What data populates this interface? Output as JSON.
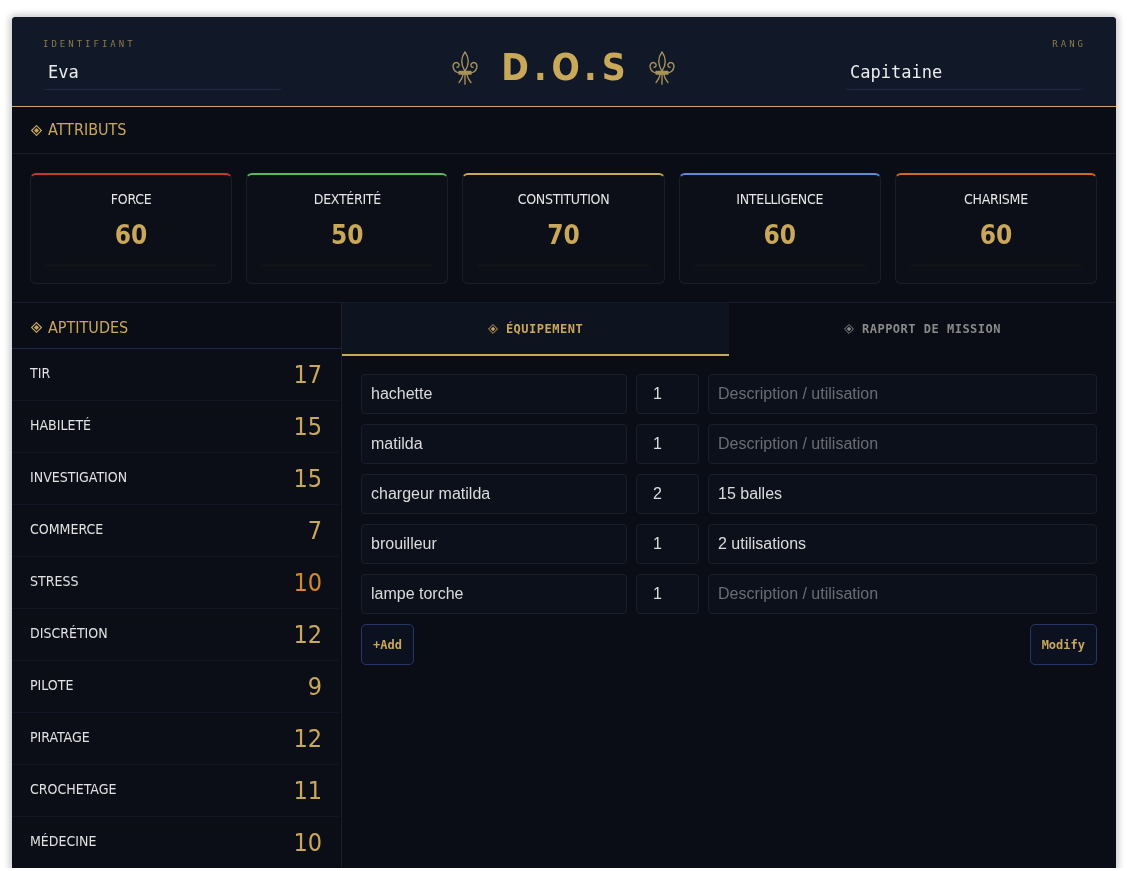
{
  "header": {
    "title": "D.O.S",
    "identity": {
      "label": "IDENTIFIANT",
      "value": "Eva"
    },
    "rank": {
      "label": "RANG",
      "value": "Capitaine"
    }
  },
  "attributes": {
    "title": "ATTRIBUTS",
    "items": [
      {
        "name": "FORCE",
        "value": "60",
        "color": "#c0392b"
      },
      {
        "name": "DEXTÉRITÉ",
        "value": "50",
        "color": "#5cb85c"
      },
      {
        "name": "CONSTITUTION",
        "value": "70",
        "color": "#c9a85a"
      },
      {
        "name": "INTELLIGENCE",
        "value": "60",
        "color": "#5b8ad6"
      },
      {
        "name": "CHARISME",
        "value": "60",
        "color": "#d2691e"
      }
    ]
  },
  "skills": {
    "title": "APTITUDES",
    "items": [
      {
        "name": "TIR",
        "value": "17",
        "alert": false
      },
      {
        "name": "HABILETÉ",
        "value": "15",
        "alert": false
      },
      {
        "name": "INVESTIGATION",
        "value": "15",
        "alert": false
      },
      {
        "name": "COMMERCE",
        "value": "7",
        "alert": false
      },
      {
        "name": "STRESS",
        "value": "10",
        "alert": true
      },
      {
        "name": "DISCRÉTION",
        "value": "12",
        "alert": false
      },
      {
        "name": "PILOTE",
        "value": "9",
        "alert": false
      },
      {
        "name": "PIRATAGE",
        "value": "12",
        "alert": false
      },
      {
        "name": "CROCHETAGE",
        "value": "11",
        "alert": false
      },
      {
        "name": "MÉDECINE",
        "value": "10",
        "alert": false
      }
    ]
  },
  "tabs": [
    {
      "label": "ÉQUIPEMENT",
      "selected": true
    },
    {
      "label": "RAPPORT DE MISSION",
      "selected": false
    }
  ],
  "equipment": {
    "items": [
      {
        "name": "hachette",
        "quantity": "1",
        "placeholder": "Description / utilisation"
      },
      {
        "name": "matilda",
        "quantity": "1",
        "placeholder": "Description / utilisation"
      },
      {
        "name": "chargeur matilda",
        "quantity": "2",
        "description": "15 balles"
      },
      {
        "name": "brouilleur",
        "quantity": "1",
        "description": "2 utilisations"
      },
      {
        "name": "lampe torche",
        "quantity": "1",
        "placeholder": "Description / utilisation"
      }
    ],
    "buttons": [
      {
        "label": "+Add",
        "kind": "add"
      },
      {
        "label": "Modify",
        "kind": "modify"
      }
    ]
  }
}
